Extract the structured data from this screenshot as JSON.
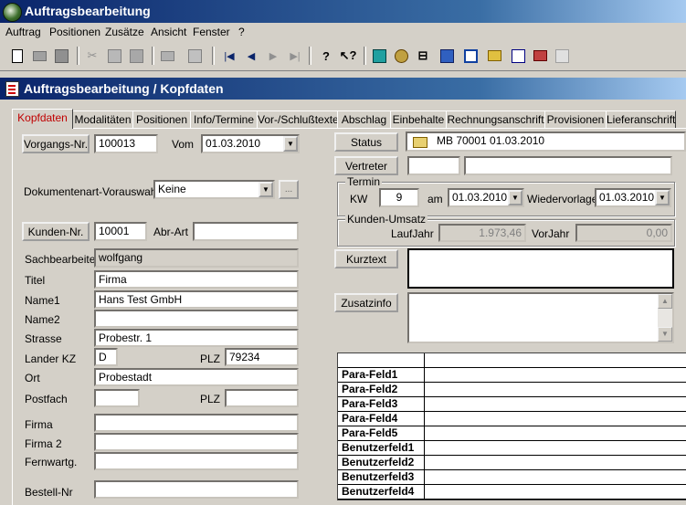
{
  "app": {
    "title": "Auftragsbearbeitung"
  },
  "menu": [
    "Auftrag",
    "Positionen",
    "Zusätze",
    "Ansicht",
    "Fenster",
    "?"
  ],
  "window": {
    "title": "Auftragsbearbeitung / Kopfdaten"
  },
  "tabs": [
    "Kopfdaten",
    "Modalitäten",
    "Positionen",
    "Info/Termine",
    "Vor-/Schlußtexte",
    "Abschlag",
    "Einbehalte",
    "Rechnungsanschrift",
    "Provisionen",
    "Lieferanschrift"
  ],
  "form": {
    "vorgangs_btn": "Vorgangs-Nr.",
    "vorgangs_nr": "100013",
    "vom_label": "Vom",
    "vom_date": "01.03.2010",
    "dokart_label": "Dokumentenart-Vorauswahl",
    "dokart_value": "Keine",
    "ellipsis": "...",
    "kunden_btn": "Kunden-Nr.",
    "kunden_nr": "10001",
    "abr_label": "Abr-Art",
    "abr_value": "",
    "sachbearbeiter_label": "Sachbearbeiter",
    "sachbearbeiter_value": "wolfgang",
    "titel_label": "Titel",
    "titel_value": "Firma",
    "name1_label": "Name1",
    "name1_value": "Hans Test GmbH",
    "name2_label": "Name2",
    "name2_value": "",
    "strasse_label": "Strasse",
    "strasse_value": "Probestr. 1",
    "landerkz_label": "Lander KZ",
    "landerkz_value": "D",
    "plz_label": "PLZ",
    "plz_value": "79234",
    "ort_label": "Ort",
    "ort_value": "Probestadt",
    "postfach_label": "Postfach",
    "postfach_value": "",
    "plz2_label": "PLZ",
    "plz2_value": "",
    "firma_label": "Firma",
    "firma_value": "",
    "firma2_label": "Firma 2",
    "firma2_value": "",
    "fernwartg_label": "Fernwartg.",
    "fernwartg_value": "",
    "bestell_label": "Bestell-Nr",
    "bestell_value": ""
  },
  "right": {
    "status_btn": "Status",
    "status_value": "MB 70001 01.03.2010",
    "vertreter_btn": "Vertreter",
    "termin_group": "Termin",
    "kw_label": "KW",
    "kw_value": "9",
    "am_label": "am",
    "am_date": "01.03.2010",
    "wiedervorlage_label": "Wiedervorlage",
    "wiedervorlage_date": "01.03.2010",
    "umsatz_group": "Kunden-Umsatz",
    "laufjahr_label": "LaufJahr",
    "laufjahr_value": "1.973,46",
    "vorjahr_label": "VorJahr",
    "vorjahr_value": "0,00",
    "kurztext_btn": "Kurztext",
    "zusatzinfo_btn": "Zusatzinfo"
  },
  "grid_rows": [
    "Para-Feld1",
    "Para-Feld2",
    "Para-Feld3",
    "Para-Feld4",
    "Para-Feld5",
    "Benutzerfeld1",
    "Benutzerfeld2",
    "Benutzerfeld3",
    "Benutzerfeld4"
  ],
  "colors": {
    "titlebar_start": "#0a246a",
    "titlebar_end": "#a6caf0",
    "active_tab": "#c00000",
    "face": "#d4d0c8"
  }
}
